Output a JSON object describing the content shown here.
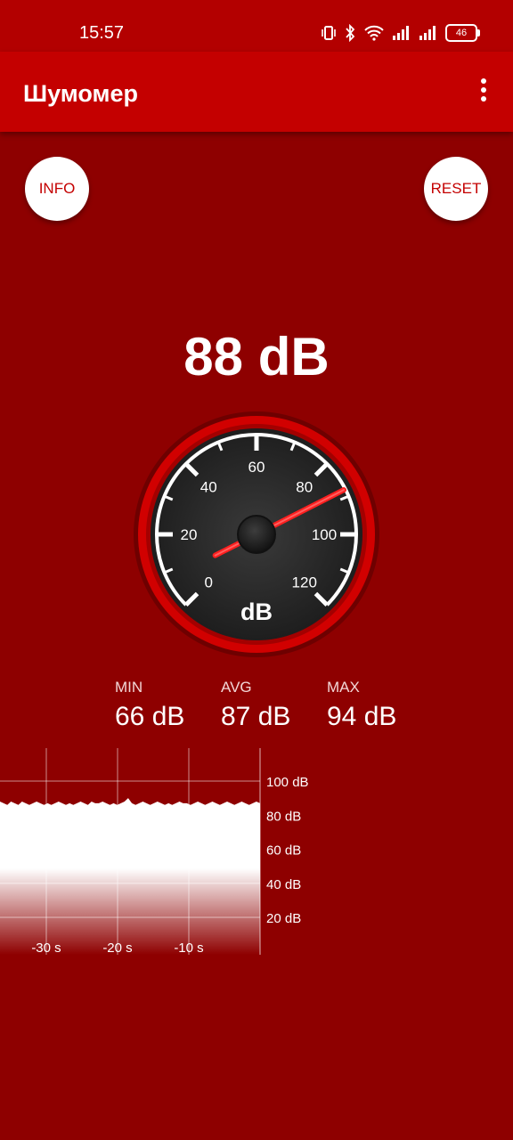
{
  "status_bar": {
    "time": "15:57",
    "battery": "46"
  },
  "app_bar": {
    "title": "Шумомер"
  },
  "buttons": {
    "info": "INFO",
    "reset": "RESET"
  },
  "reading": {
    "value": 88,
    "unit": "dB",
    "text": "88 dB"
  },
  "gauge": {
    "unit_label": "dB",
    "scale_min": 0,
    "scale_max": 120,
    "value": 88,
    "tick_labels": [
      "0",
      "20",
      "40",
      "60",
      "80",
      "100",
      "120"
    ],
    "colors": {
      "needle": "#ff1f1f",
      "dial": "#2b2b2b",
      "rim": "#d10000"
    }
  },
  "stats": {
    "min": {
      "label": "MIN",
      "value": "66 dB"
    },
    "avg": {
      "label": "AVG",
      "value": "87 dB"
    },
    "max": {
      "label": "MAX",
      "value": "94 dB"
    }
  },
  "chart_data": {
    "type": "area",
    "x_ticks": [
      "-30 s",
      "-20 s",
      "-10 s"
    ],
    "y_ticks": [
      "100 dB",
      "80 dB",
      "60 dB",
      "40 dB",
      "20 dB"
    ],
    "x_range": [
      -36,
      0
    ],
    "ylim": [
      10,
      110
    ],
    "series": [
      {
        "values": [
          88,
          87,
          86,
          88,
          87,
          86,
          88,
          87,
          86,
          87,
          88,
          87,
          86,
          87,
          86,
          87,
          88,
          87,
          86,
          87,
          86,
          87,
          88,
          87,
          86,
          88,
          87,
          87,
          88,
          87,
          86,
          87,
          86,
          87,
          88,
          90,
          87,
          86,
          87,
          88,
          87,
          86,
          87,
          88,
          87,
          86,
          87,
          86,
          87,
          88,
          87,
          87,
          86,
          87,
          88,
          87,
          86,
          87,
          88,
          87,
          86,
          87,
          88,
          87,
          86,
          87,
          88,
          87,
          86,
          87,
          88,
          87
        ]
      }
    ],
    "grid": true
  }
}
